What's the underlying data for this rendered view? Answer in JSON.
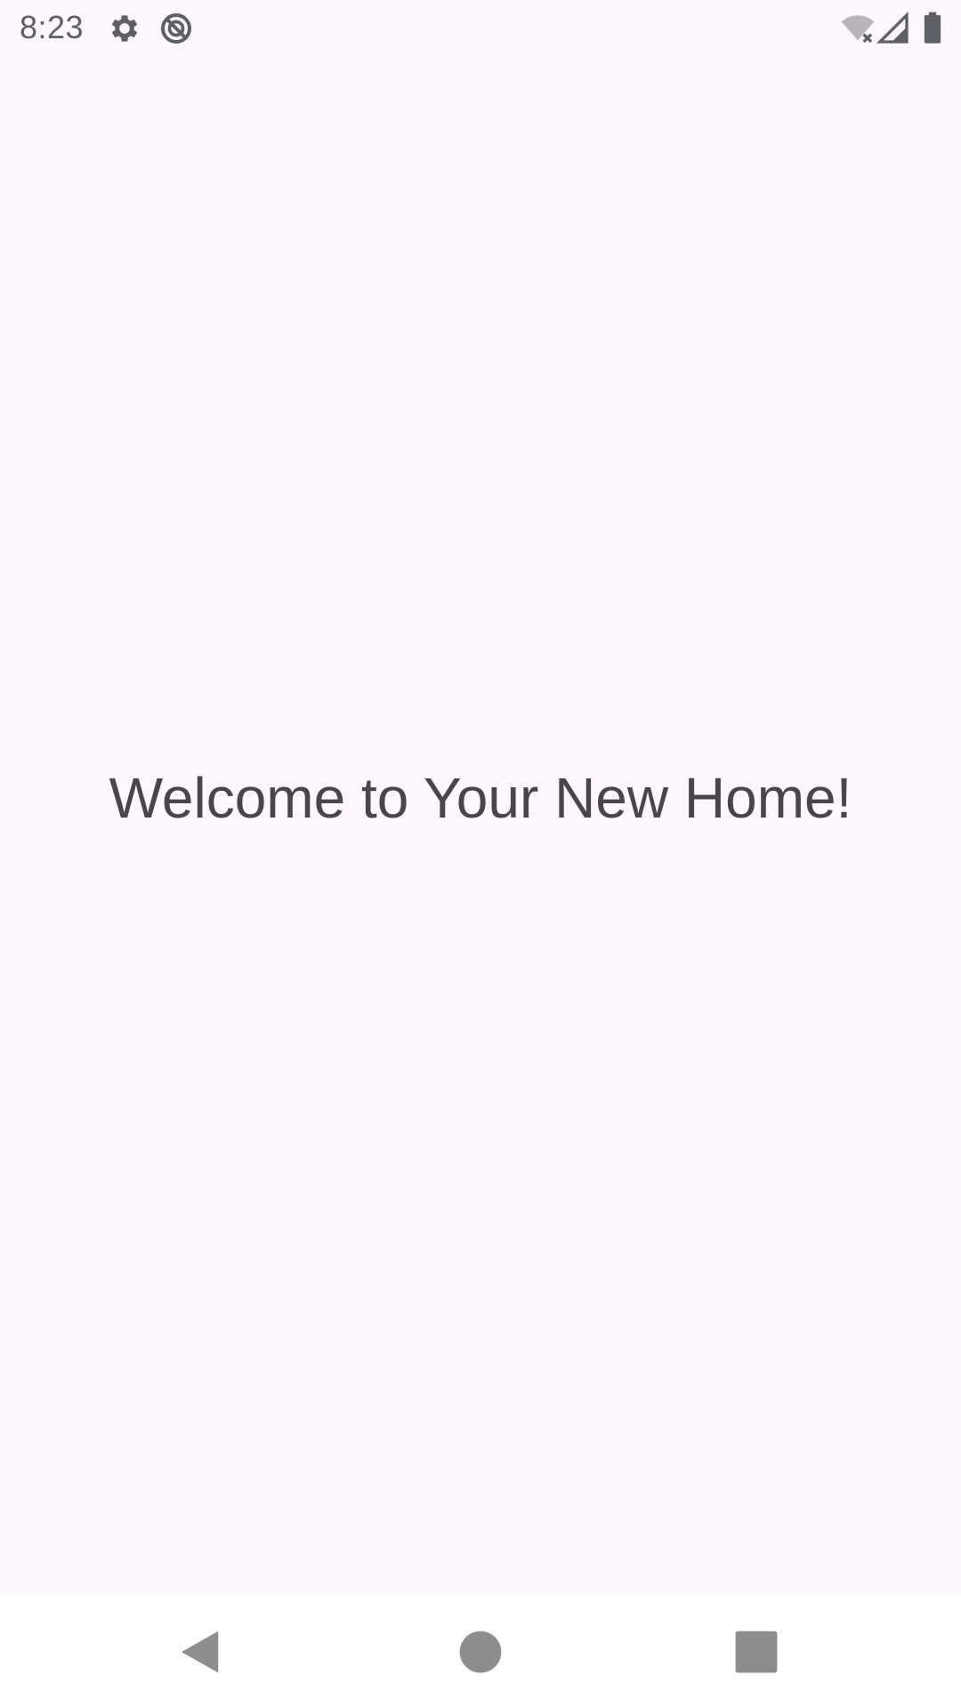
{
  "status_bar": {
    "time": "8:23",
    "icons": [
      "settings-icon",
      "do-not-disturb-icon",
      "wifi-off-icon",
      "cell-signal-icon",
      "battery-icon"
    ]
  },
  "main": {
    "welcome_text": "Welcome to Your New Home!"
  },
  "nav_bar": {
    "buttons": [
      "back-icon",
      "home-icon",
      "recents-icon"
    ]
  },
  "colors": {
    "background": "#fdf6fd",
    "text": "#4a444c",
    "status_icon": "#5f5f66",
    "nav_icon": "#8e8e8e"
  }
}
